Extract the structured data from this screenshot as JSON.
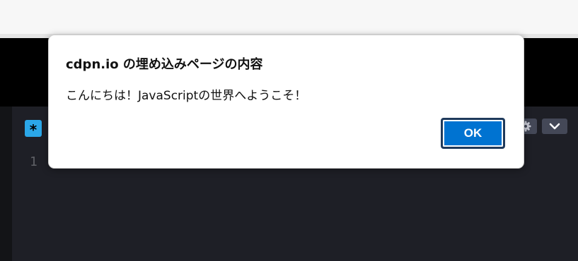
{
  "dialog": {
    "title": "cdpn.io の埋め込みページの内容",
    "message": "こんにちは！JavaScriptの世界へようこそ！",
    "ok_label": "OK"
  },
  "editor": {
    "badge_symbol": "*",
    "line_numbers": [
      "1"
    ]
  },
  "icons": {
    "gear": "gear-icon",
    "chevron": "chevron-down-icon"
  },
  "colors": {
    "ok_button": "#0073d1",
    "editor_background": "#1e1f26",
    "badge": "#2ba7e8"
  }
}
